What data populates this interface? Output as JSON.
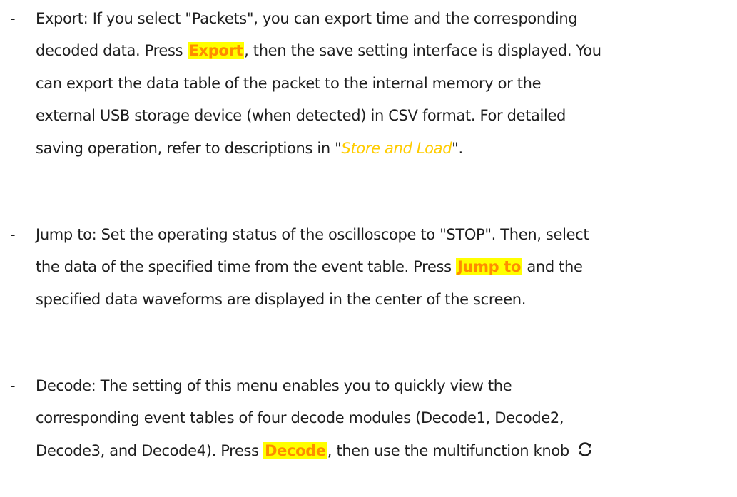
{
  "bullets": [
    {
      "marker": "-",
      "lines": [
        [
          "Export: If you select \"Packets\", you can export time and the corresponding"
        ],
        [
          "decoded data. Press ",
          {
            "hl": "Export"
          },
          ", then the save setting interface is displayed. You"
        ],
        [
          "can export the data table of the packet to the internal memory or the"
        ],
        [
          "external USB storage device (when detected) in CSV format. For detailed"
        ],
        [
          "saving operation, refer to descriptions in \"",
          {
            "link": "Store and Load"
          },
          "\"."
        ]
      ]
    },
    {
      "marker": "-",
      "lines": [
        [
          "Jump to: Set the operating status of the oscilloscope to \"STOP\". Then, select"
        ],
        [
          "the data of the specified time from the event table. Press ",
          {
            "hl": "Jump to"
          },
          " and the"
        ],
        [
          "specified data waveforms are displayed in the center of the screen."
        ]
      ]
    },
    {
      "marker": "-",
      "lines": [
        [
          "Decode: The setting of this menu enables you to quickly view the"
        ],
        [
          "corresponding event tables of four decode modules (Decode1, Decode2,"
        ],
        [
          "Decode3, and Decode4). Press ",
          {
            "hl": "Decode"
          },
          ", then use the multifunction knob ",
          {
            "icon": "rotate-knob-icon"
          }
        ]
      ]
    }
  ],
  "colors": {
    "text": "#1e1e1e",
    "highlight_bg": "#ffff00",
    "highlight_text": "#ff8c00",
    "link": "#ffcc00"
  }
}
